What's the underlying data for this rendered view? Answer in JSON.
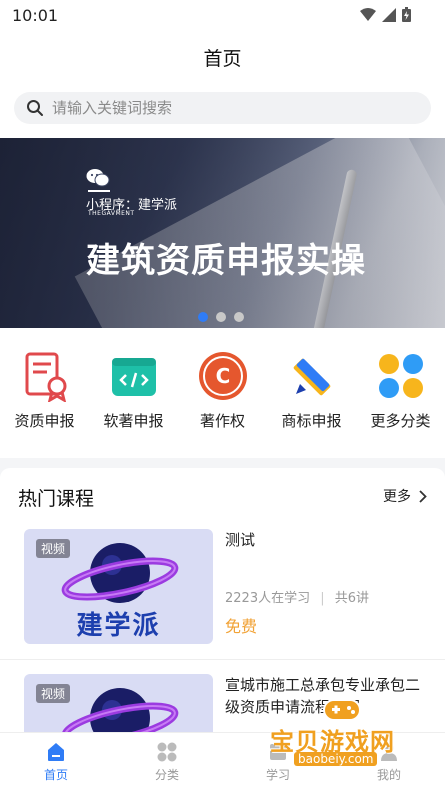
{
  "status_bar": {
    "time": "10:01"
  },
  "header": {
    "title": "首页"
  },
  "search": {
    "placeholder": "请输入关键词搜索"
  },
  "banner": {
    "subtitle": "小程序：建学派",
    "subtitle_en": "THEGAVMENT",
    "title": "建筑资质申报实操",
    "dots": 3,
    "active_dot": 1
  },
  "categories": [
    {
      "label": "资质申报",
      "icon": "certificate-icon"
    },
    {
      "label": "软著申报",
      "icon": "code-icon"
    },
    {
      "label": "著作权",
      "icon": "copyright-icon"
    },
    {
      "label": "商标申报",
      "icon": "pencil-ruler-icon"
    },
    {
      "label": "更多分类",
      "icon": "more-categories-icon"
    }
  ],
  "hot_courses": {
    "title": "热门课程",
    "more": "更多",
    "items": [
      {
        "tag": "视频",
        "brand": "建学派",
        "title": "测试",
        "learners": "2223人在学习",
        "lessons": "共6讲",
        "price": "免费"
      },
      {
        "tag": "视频",
        "title": "宣城市施工总承包专业承包二级资质申请流程介绍"
      }
    ]
  },
  "tabbar": [
    {
      "label": "首页",
      "icon": "home-icon",
      "active": true
    },
    {
      "label": "分类",
      "icon": "grid-icon",
      "active": false
    },
    {
      "label": "学习",
      "icon": "book-icon",
      "active": false
    },
    {
      "label": "我的",
      "icon": "user-icon",
      "active": false
    }
  ],
  "watermark": {
    "text": "宝贝游戏网",
    "url": "baobeiy.com"
  },
  "colors": {
    "accent": "#2f7cf6",
    "price": "#f1a235",
    "search_bg": "#f1f2f4"
  }
}
